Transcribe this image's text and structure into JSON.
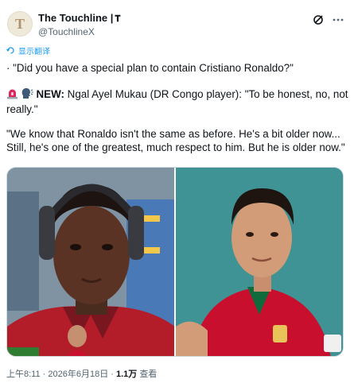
{
  "account": {
    "display_name": "The Touchline |",
    "badge": "𝐓",
    "handle": "@TouchlineX",
    "avatar_letter": "T"
  },
  "icons": {
    "grok": "grok-icon",
    "more": "more-icon",
    "translate": "translate-icon",
    "siren": "siren-emoji",
    "speaking_head": "speaking-head-emoji"
  },
  "tweet": {
    "translate_label": "显示翻译",
    "line1": "· \"Did you have a special plan to contain Cristiano Ronaldo?\"",
    "new_label": "NEW:",
    "line2": " Ngal Ayel Mukau (DR Congo player): \"To be honest, no, not really.\"",
    "line3": "\"We know that Ronaldo isn't the same as before. He's a bit older now... Still, he's one of the greatest, much respect to him. But he is older now.\""
  },
  "meta": {
    "time": "上午8:11",
    "sep": " · ",
    "date": "2026年6月18日",
    "views": "1.1万",
    "views_label": " 查看"
  },
  "colors": {
    "link_blue": "#1d9bf0",
    "secondary_text": "#536471",
    "primary_text": "#0f1419",
    "portugal_red": "#c8102e",
    "teal_bg": "#3e8f90"
  }
}
